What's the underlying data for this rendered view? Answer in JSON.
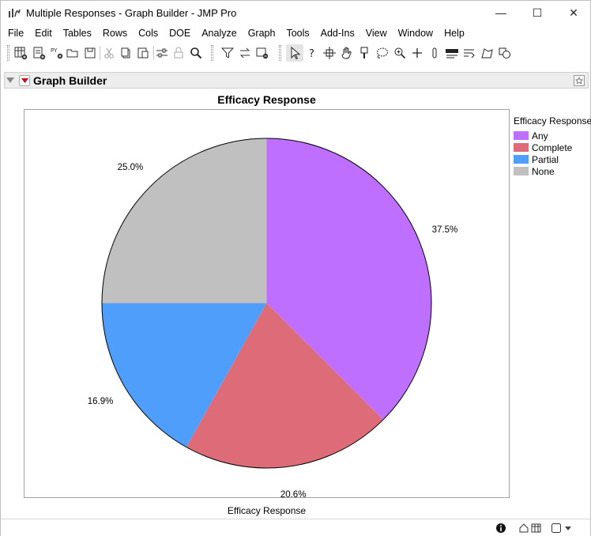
{
  "window": {
    "title": "Multiple Responses - Graph Builder - JMP Pro",
    "controls": {
      "minimize": "—",
      "maximize": "☐",
      "close": "✕"
    }
  },
  "menu": [
    "File",
    "Edit",
    "Tables",
    "Rows",
    "Cols",
    "DOE",
    "Analyze",
    "Graph",
    "Tools",
    "Add-Ins",
    "View",
    "Window",
    "Help"
  ],
  "toolbar": {
    "icons": [
      "new-data-table-icon",
      "new-script-icon",
      "new-python-script-icon",
      "open-icon",
      "save-icon",
      "cut-icon",
      "copy-icon",
      "paste-icon",
      "settings-icon",
      "lock-icon",
      "search-icon",
      "filter-icon",
      "swap-icon",
      "add-graph-icon",
      "arrow-select-icon",
      "help-icon",
      "crosshair-icon",
      "brush-icon",
      "hand-icon",
      "lasso-icon",
      "zoom-icon",
      "plus-icon",
      "scroller-icon",
      "spelling-icon",
      "text-wrap-icon",
      "annotation-shape-icon",
      "simple-shape-icon"
    ],
    "python_badge": "PY"
  },
  "panel": {
    "title": "Graph Builder"
  },
  "chart_data": {
    "type": "pie",
    "title": "Efficacy Response",
    "xlabel": "Efficacy Response",
    "legend_title": "Efficacy Response",
    "legend_position": "right",
    "categories": [
      "Any",
      "Complete",
      "Partial",
      "None"
    ],
    "values": [
      37.5,
      20.6,
      16.9,
      25.0
    ],
    "labels": [
      "37.5%",
      "20.6%",
      "16.9%",
      "25.0%"
    ],
    "colors": [
      "#bf6ffd",
      "#de6c78",
      "#4f9efc",
      "#c0c0c0"
    ],
    "start_angle_deg": 0,
    "direction": "clockwise"
  },
  "statusbar": {
    "icons": [
      "info-icon",
      "home-icon",
      "data-table-icon",
      "checkbox-icon",
      "dropdown-arrow-icon"
    ]
  }
}
